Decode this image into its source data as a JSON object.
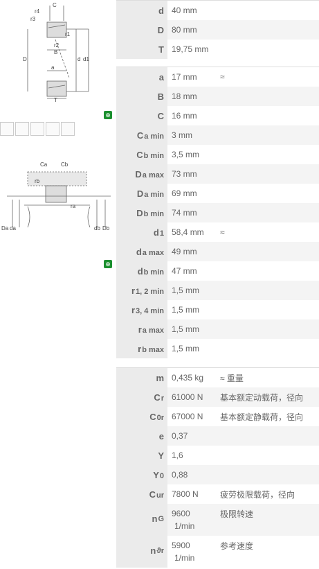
{
  "groups": [
    [
      {
        "sym": "d",
        "sub": "",
        "value": "40  mm",
        "note": ""
      },
      {
        "sym": "D",
        "sub": "",
        "value": "80  mm",
        "note": ""
      },
      {
        "sym": "T",
        "sub": "",
        "value": "19,75  mm",
        "note": ""
      }
    ],
    [
      {
        "sym": "a",
        "sub": "",
        "value": "17  mm",
        "note": "≈"
      },
      {
        "sym": "B",
        "sub": "",
        "value": "18  mm",
        "note": ""
      },
      {
        "sym": "C",
        "sub": "",
        "value": "16  mm",
        "note": ""
      },
      {
        "sym": "C",
        "sub": "a min",
        "value": "3  mm",
        "note": ""
      },
      {
        "sym": "C",
        "sub": "b min",
        "value": "3,5  mm",
        "note": ""
      },
      {
        "sym": "D",
        "sub": "a max",
        "value": "73  mm",
        "note": ""
      },
      {
        "sym": "D",
        "sub": "a min",
        "value": "69  mm",
        "note": ""
      },
      {
        "sym": "D",
        "sub": "b min",
        "value": "74  mm",
        "note": ""
      },
      {
        "sym": "d",
        "sub": "1",
        "value": "58,4  mm",
        "note": "≈"
      },
      {
        "sym": "d",
        "sub": "a max",
        "value": "49  mm",
        "note": ""
      },
      {
        "sym": "d",
        "sub": "b min",
        "value": "47  mm",
        "note": ""
      },
      {
        "sym": "r",
        "sub": "1, 2 min",
        "value": "1,5  mm",
        "note": ""
      },
      {
        "sym": "r",
        "sub": "3, 4 min",
        "value": "1,5  mm",
        "note": ""
      },
      {
        "sym": "r",
        "sub": "a max",
        "value": "1,5  mm",
        "note": ""
      },
      {
        "sym": "r",
        "sub": "b max",
        "value": "1,5  mm",
        "note": ""
      }
    ],
    [
      {
        "sym": "m",
        "sub": "",
        "value": "0,435  kg",
        "note": "≈ 重量"
      },
      {
        "sym": "C",
        "sub": "r",
        "value": "61000  N",
        "note": "基本额定动载荷，径向"
      },
      {
        "sym": "C",
        "sub": "0r",
        "value": "67000  N",
        "note": "基本额定静载荷，径向"
      },
      {
        "sym": "e",
        "sub": "",
        "value": "0,37",
        "note": ""
      },
      {
        "sym": "Y",
        "sub": "",
        "value": "1,6",
        "note": ""
      },
      {
        "sym": "Y",
        "sub": "0",
        "value": "0,88",
        "note": ""
      },
      {
        "sym": "C",
        "sub": "ur",
        "value": "7800  N",
        "note": "疲劳极限载荷，径向"
      },
      {
        "sym": "n",
        "sub": "G",
        "value": "9600",
        "value2": "1/min",
        "note": "极限转速"
      },
      {
        "sym": "n",
        "sub": "ϑr",
        "value": "5900",
        "value2": "1/min",
        "note": "参考速度"
      }
    ]
  ],
  "diagram1": {
    "labels": [
      "C",
      "r4",
      "r3",
      "r2",
      "r1",
      "B",
      "D",
      "d",
      "d1",
      "a",
      "T"
    ]
  },
  "diagram2": {
    "labels": [
      "Ca",
      "Cb",
      "rb",
      "ra",
      "Da",
      "da",
      "db",
      "Db"
    ]
  }
}
